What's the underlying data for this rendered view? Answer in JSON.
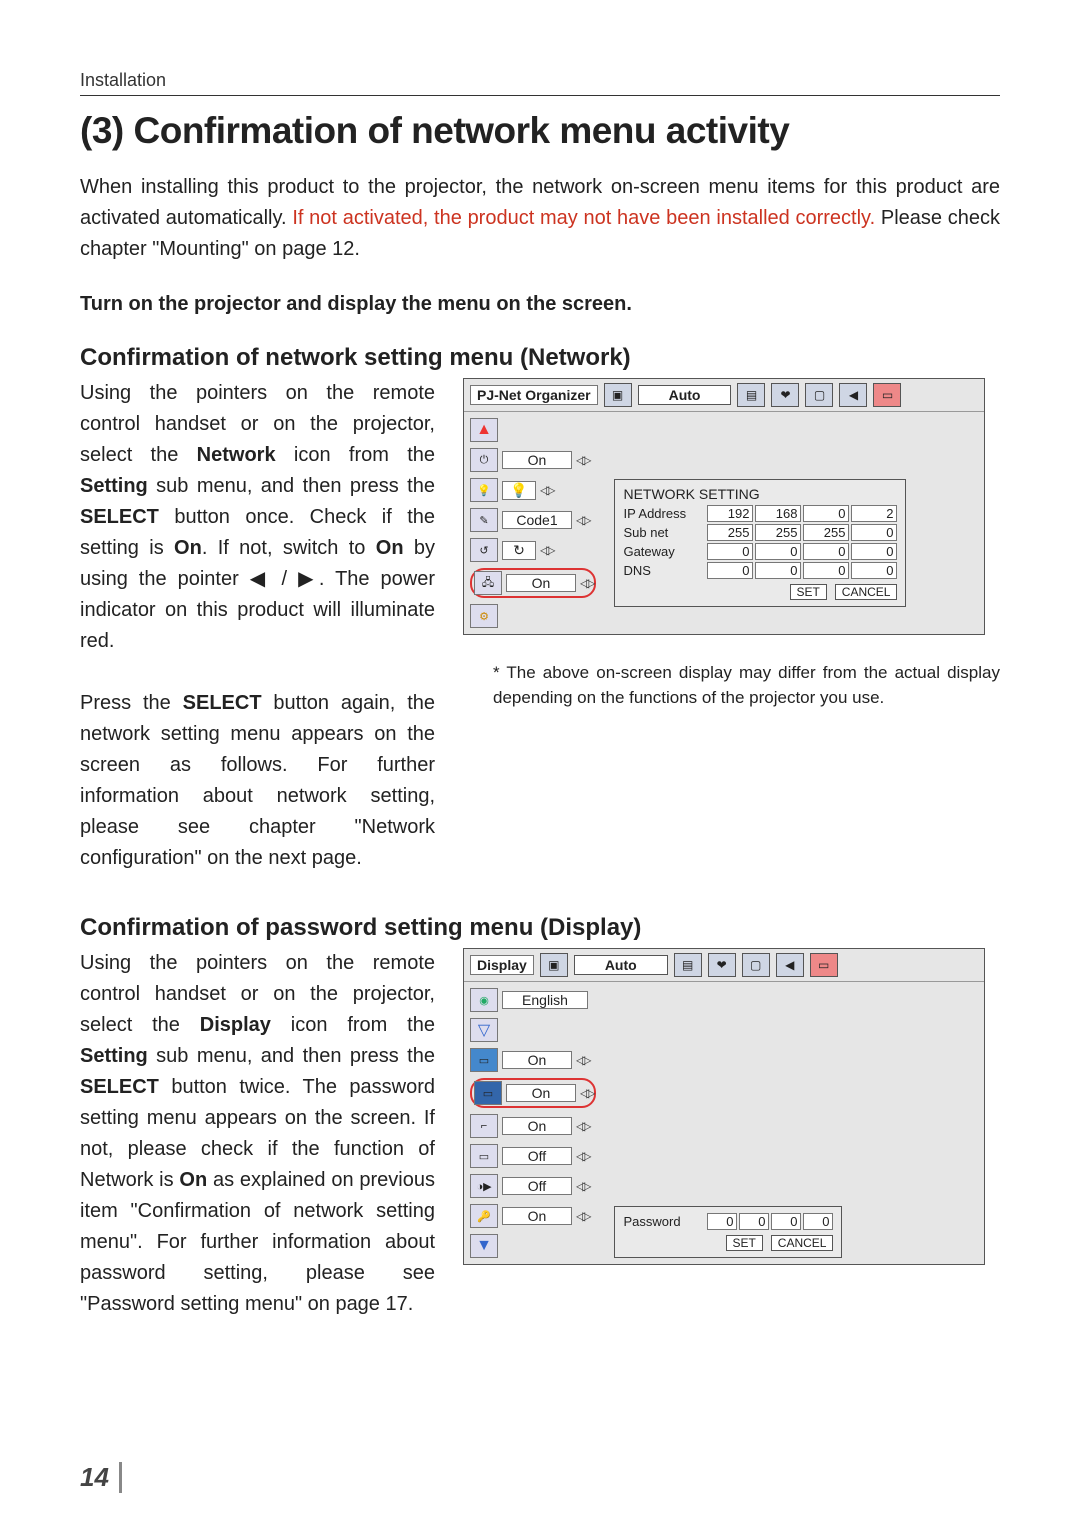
{
  "section_label": "Installation",
  "title": "(3) Confirmation of network menu activity",
  "intro": {
    "pre": "When installing this product to the projector, the network on-screen menu items for this product are activated automatically. ",
    "warn": "If not activated, the product may not have been installed correctly.",
    "post": " Please check chapter \"Mounting\" on page 12."
  },
  "instruction": "Turn on the projector and display the menu on the screen.",
  "section1": {
    "heading": "Confirmation of network setting menu (Network)",
    "para1_a": "Using the pointers on the remote control handset or on the projector, select the ",
    "para1_b": "Network",
    "para1_c": " icon from the ",
    "para1_d": "Setting",
    "para1_e": " sub menu, and then press the ",
    "para1_f": "SELECT",
    "para1_g": " button once. Check if the setting is ",
    "para1_h": "On",
    "para1_i": ". If not, switch to ",
    "para1_j": "On",
    "para1_k": " by using the pointer ◀ / ▶. The power indicator on this product will illuminate red.",
    "para2_a": "Press the ",
    "para2_b": "SELECT",
    "para2_c": " button again, the network setting menu appears on the screen as follows. For further information about network setting, please see chapter \"Network configuration\" on the next page.",
    "caption": "* The above on-screen display may differ from the actual display depending on the functions of the projector you use."
  },
  "osd1": {
    "title": "PJ-Net Organizer",
    "auto": "Auto",
    "rows": {
      "on1": "On",
      "code": "Code1",
      "on2": "On"
    },
    "popup": {
      "title": "NETWORK SETTING",
      "ip_label": "IP Address",
      "ip": [
        "192",
        "168",
        "0",
        "2"
      ],
      "sub_label": "Sub net",
      "sub": [
        "255",
        "255",
        "255",
        "0"
      ],
      "gw_label": "Gateway",
      "gw": [
        "0",
        "0",
        "0",
        "0"
      ],
      "dns_label": "DNS",
      "dns": [
        "0",
        "0",
        "0",
        "0"
      ],
      "set": "SET",
      "cancel": "CANCEL"
    }
  },
  "section2": {
    "heading": "Confirmation of password setting menu (Display)",
    "para_a": "Using the pointers on the remote control handset or on the projector, select the ",
    "para_b": "Display",
    "para_c": " icon from the ",
    "para_d": "Setting",
    "para_e": " sub menu, and then press the ",
    "para_f": "SELECT",
    "para_g": " button twice. The password setting menu appears on the screen. If not, please check if the function of Network is ",
    "para_h": "On",
    "para_i": " as explained on previous item \"Confirmation of network setting menu\". For further information about password setting, please see \"Password setting menu\" on page 17."
  },
  "osd2": {
    "title": "Display",
    "auto": "Auto",
    "rows": {
      "lang": "English",
      "v1": "On",
      "v2": "On",
      "v3": "On",
      "v4": "Off",
      "v5": "Off",
      "v6": "On"
    },
    "popup": {
      "label": "Password",
      "vals": [
        "0",
        "0",
        "0",
        "0"
      ],
      "set": "SET",
      "cancel": "CANCEL"
    }
  },
  "page_number": "14"
}
